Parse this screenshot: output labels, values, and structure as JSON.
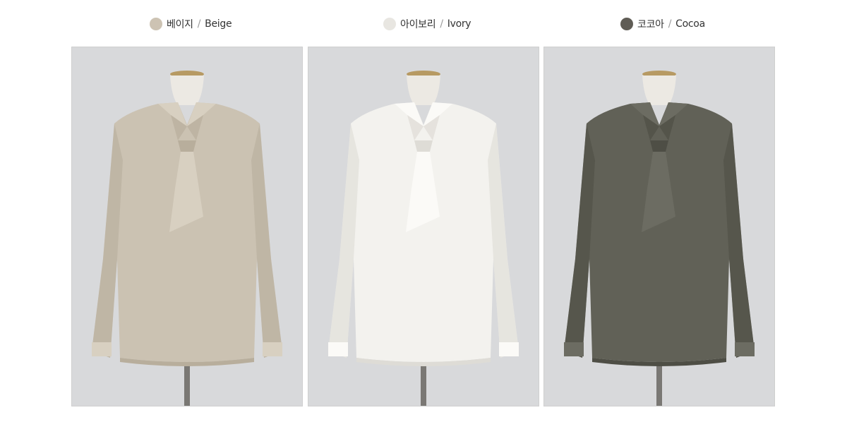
{
  "colors": [
    {
      "name_ko": "베이지",
      "separator": "/",
      "name_en": "Beige",
      "swatch": "#cdc3b3",
      "garment": "#cbc2b2",
      "garment_shade": "#b8ae9c",
      "garment_light": "#d8d0c1",
      "photo": "photo-blouse-beige"
    },
    {
      "name_ko": "아이보리",
      "separator": "/",
      "name_en": "Ivory",
      "swatch": "#e8e6e1",
      "garment": "#f3f2ee",
      "garment_shade": "#dedcd6",
      "garment_light": "#fbfaf7",
      "photo": "photo-blouse-ivory"
    },
    {
      "name_ko": "코코아",
      "separator": "/",
      "name_en": "Cocoa",
      "swatch": "#5f5c55",
      "garment": "#616157",
      "garment_shade": "#4e4e45",
      "garment_light": "#6c6c62",
      "photo": "photo-blouse-cocoa"
    }
  ],
  "backdrop": "#d8d9db",
  "mannequin": "#ece9e3",
  "stand": "#7a7874"
}
